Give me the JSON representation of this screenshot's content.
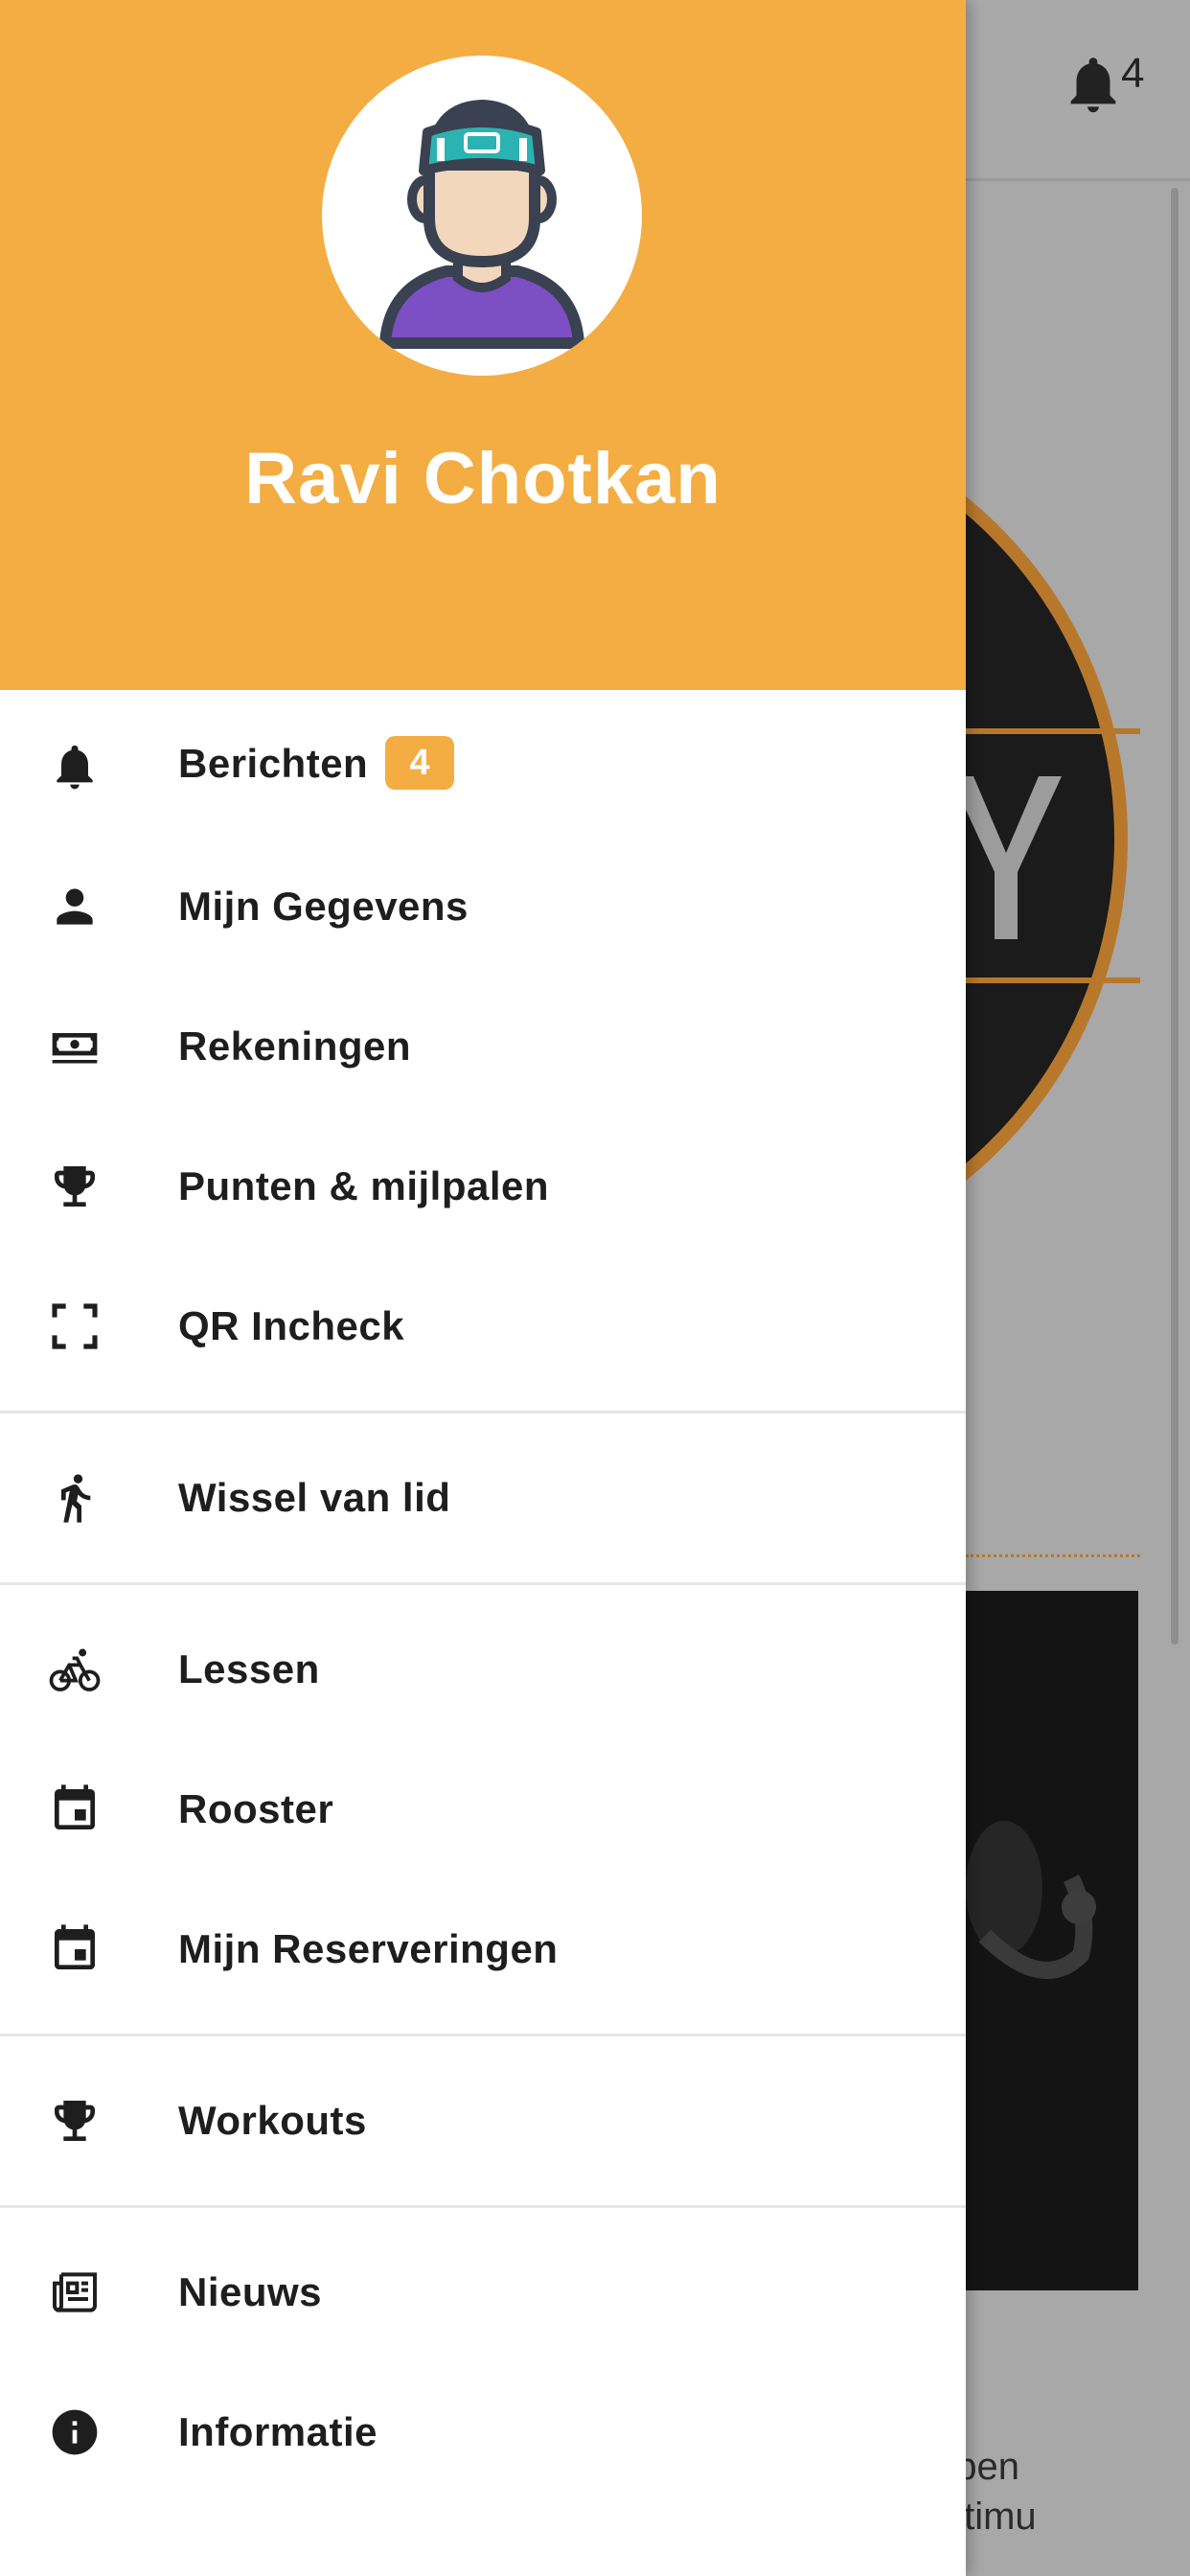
{
  "background": {
    "notification_count": "4",
    "text_line_1": "bben",
    "text_line_2": " stimu"
  },
  "drawer": {
    "user_name": "Ravi Chotkan",
    "header_color": "#f4ad42",
    "menu_groups": [
      [
        {
          "name": "berichten",
          "icon": "bell-icon",
          "label": "Berichten",
          "badge": "4"
        },
        {
          "name": "mijn-gegevens",
          "icon": "person-icon",
          "label": "Mijn Gegevens"
        },
        {
          "name": "rekeningen",
          "icon": "money-icon",
          "label": "Rekeningen"
        },
        {
          "name": "punten-mijlpalen",
          "icon": "trophy-icon",
          "label": "Punten & mijlpalen"
        },
        {
          "name": "qr-incheck",
          "icon": "scan-frame-icon",
          "label": "QR Incheck"
        }
      ],
      [
        {
          "name": "wissel-van-lid",
          "icon": "walking-icon",
          "label": "Wissel van lid"
        }
      ],
      [
        {
          "name": "lessen",
          "icon": "bicycle-icon",
          "label": "Lessen"
        },
        {
          "name": "rooster",
          "icon": "calendar-icon",
          "label": "Rooster"
        },
        {
          "name": "mijn-reserveringen",
          "icon": "calendar-icon",
          "label": "Mijn Reserveringen"
        }
      ],
      [
        {
          "name": "workouts",
          "icon": "trophy-icon",
          "label": "Workouts"
        }
      ],
      [
        {
          "name": "nieuws",
          "icon": "newspaper-icon",
          "label": "Nieuws"
        },
        {
          "name": "informatie",
          "icon": "info-icon",
          "label": "Informatie"
        }
      ]
    ]
  }
}
